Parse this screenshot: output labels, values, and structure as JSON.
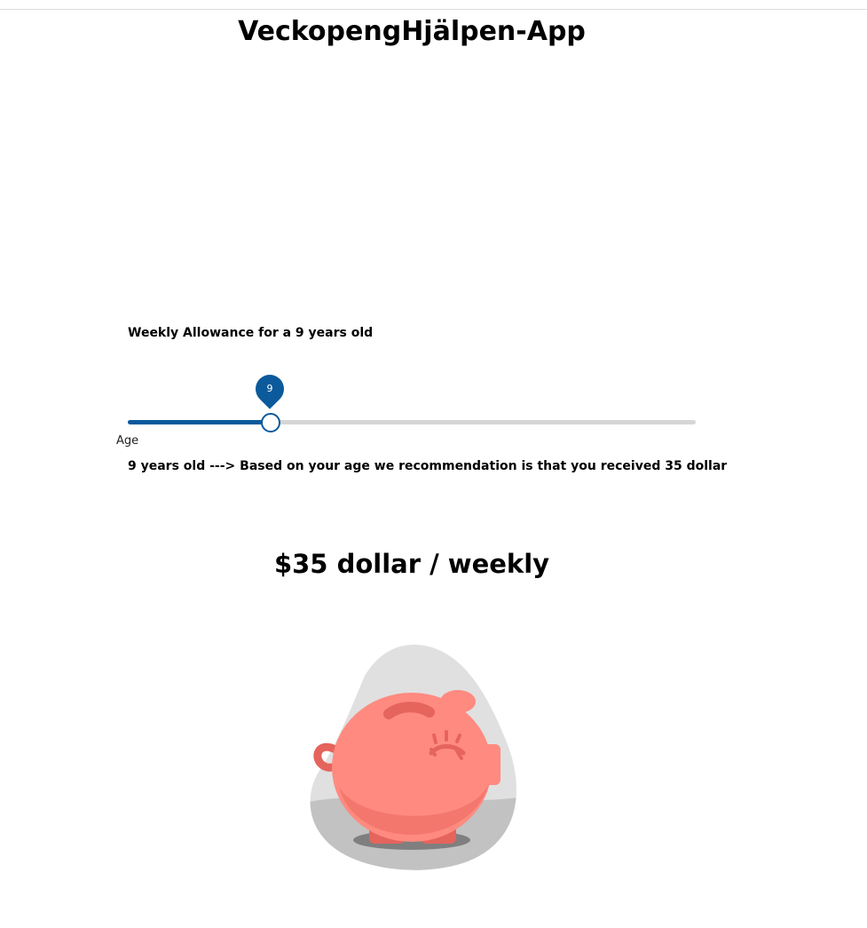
{
  "app": {
    "title": "VeckopengHjälpen-App"
  },
  "allowance": {
    "heading": "Weekly Allowance for a 9 years old",
    "slider_label": "Age",
    "slider_value": "9",
    "slider_min": 0,
    "slider_max": 40,
    "slider_position_fraction": 0.25,
    "recommendation_text": "9 years old ---> Based on your age we recommendation is that you received 35 dollar",
    "amount_text": "$35 dollar / weekly"
  },
  "illustration": {
    "icon": "piggy-bank-icon"
  },
  "colors": {
    "accent": "#0b5a9c",
    "track": "#d6d6d6",
    "pig": "#ff8a80",
    "pig_dark": "#e5645c",
    "blob": "#e0e0e0"
  }
}
